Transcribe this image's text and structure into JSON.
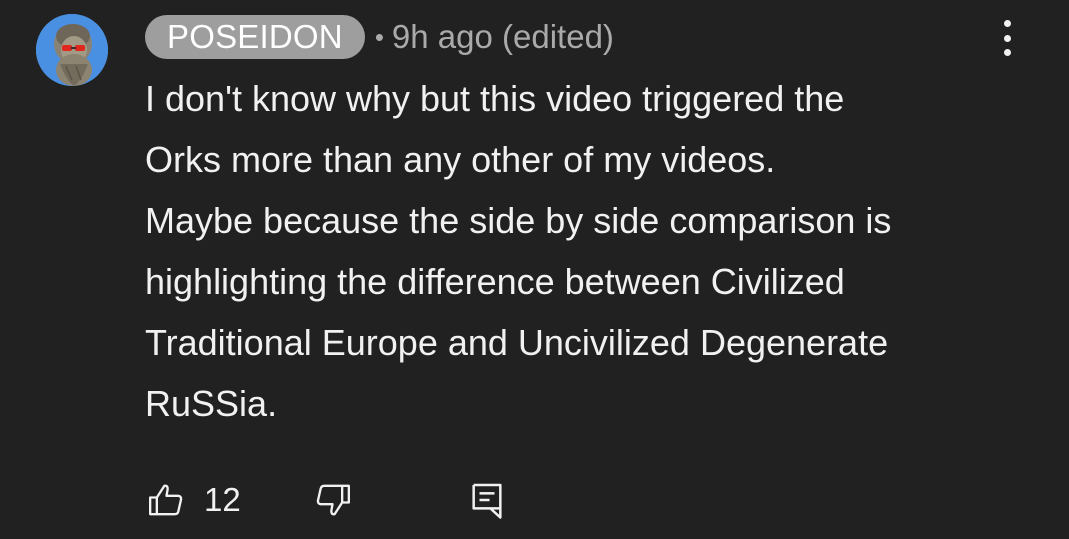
{
  "comment": {
    "author": "POSEIDON",
    "separator": "•",
    "timestamp": "9h ago (edited)",
    "lines": [
      "I don't know why but this video triggered the",
      "Orks more than any other of my videos.",
      "Maybe because the side by side comparison is",
      "highlighting the difference between Civilized",
      "Traditional Europe and Uncivilized Degenerate",
      "RuSSia."
    ],
    "like_count": "12"
  },
  "icons": {
    "avatar": "poseidon-statue-avatar",
    "more": "more-vert-icon",
    "like": "thumb-up-icon",
    "dislike": "thumb-down-icon",
    "reply": "reply-comment-icon"
  },
  "colors": {
    "background": "#212121",
    "text": "#f1f1f1",
    "secondary_text": "#aaaaaa",
    "author_chip": "#9e9e9e",
    "avatar_bg": "#4a90e2"
  }
}
